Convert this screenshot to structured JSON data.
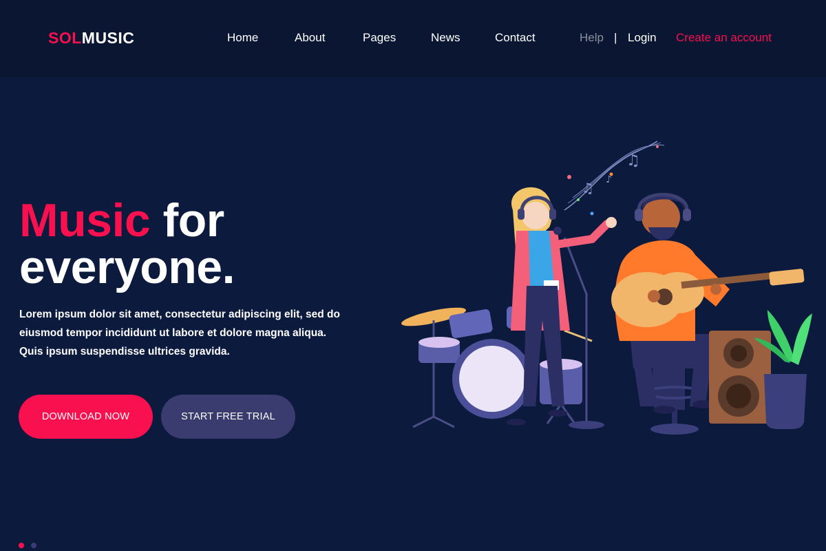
{
  "brand": {
    "part1": "SOL",
    "part2": "MUSIC"
  },
  "nav": {
    "items": [
      "Home",
      "About",
      "Pages",
      "News",
      "Contact"
    ],
    "help": "Help",
    "separator": "|",
    "login": "Login",
    "create_account": "Create an account"
  },
  "hero": {
    "title_accent": "Music",
    "title_rest": " for",
    "title_line2": "everyone.",
    "description": "Lorem ipsum dolor sit amet, consectetur adipiscing elit, sed do eiusmod tempor incididunt ut labore et dolore magna aliqua. Quis ipsum suspendisse ultrices gravida.",
    "primary_button": "DOWNLOAD NOW",
    "secondary_button": "START FREE TRIAL"
  },
  "slider": {
    "dots": 2,
    "active": 1
  },
  "colors": {
    "background": "#0c1a3e",
    "header": "#0a1632",
    "accent": "#f8104f",
    "secondary_button": "#3a3b6e",
    "muted": "#8b8f9e"
  }
}
